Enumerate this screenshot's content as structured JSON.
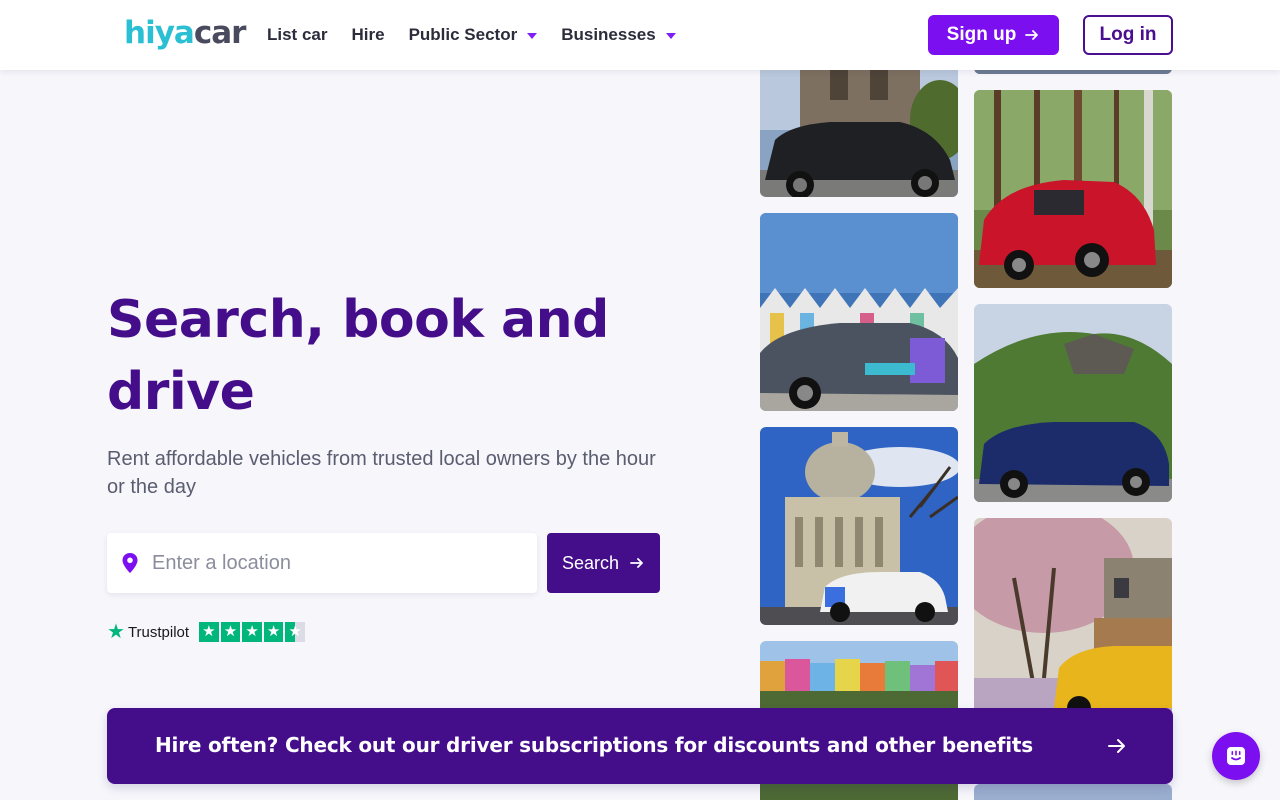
{
  "header": {
    "logo_part1": "hiya",
    "logo_part2": "car",
    "nav": [
      {
        "label": "List car",
        "dropdown": false
      },
      {
        "label": "Hire",
        "dropdown": false
      },
      {
        "label": "Public Sector",
        "dropdown": true
      },
      {
        "label": "Businesses",
        "dropdown": true
      }
    ],
    "signup_label": "Sign up",
    "login_label": "Log in"
  },
  "hero": {
    "title": "Search, book and drive",
    "subtitle": "Rent affordable vehicles from trusted local owners by the hour or the day",
    "search": {
      "placeholder": "Enter a location",
      "value": "",
      "button_label": "Search"
    },
    "trustpilot": {
      "brand": "Trustpilot",
      "rating_stars": 4.5,
      "max_stars": 5
    }
  },
  "photos": [
    {
      "name": "black-car-castle-photo"
    },
    {
      "name": "red-car-forest-photo"
    },
    {
      "name": "grey-car-beach-huts-photo"
    },
    {
      "name": "blue-car-edinburgh-photo"
    },
    {
      "name": "white-car-st-pauls-photo"
    },
    {
      "name": "yellow-car-blossom-photo"
    },
    {
      "name": "colourful-houses-photo"
    }
  ],
  "banner": {
    "text": "Hire often? Check out our driver subscriptions for discounts and other benefits"
  },
  "colors": {
    "brand_purple": "#440d8a",
    "accent_purple": "#7b0ff0",
    "logo_teal": "#2bbfd4",
    "trustpilot_green": "#00b67a"
  }
}
